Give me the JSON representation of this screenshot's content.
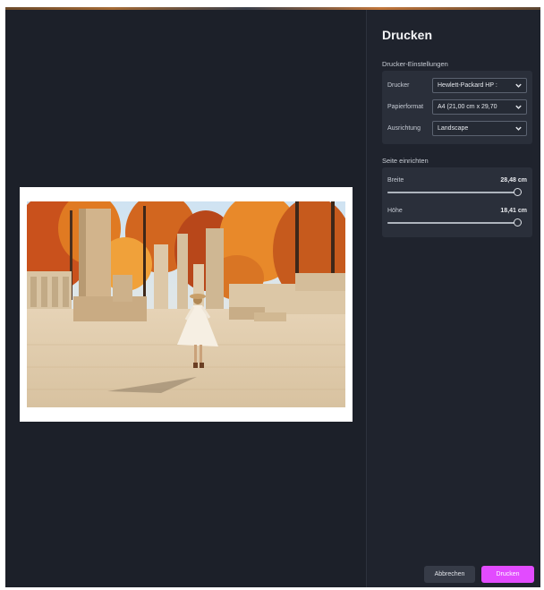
{
  "dialog": {
    "title": "Drucken",
    "printer_section_label": "Drucker-Einstellungen",
    "page_section_label": "Seite einrichten"
  },
  "printer_settings": {
    "printer": {
      "label": "Drucker",
      "value": "Hewlett-Packard HP :"
    },
    "paper_format": {
      "label": "Papierformat",
      "value": "A4 (21,00 cm x 29,70"
    },
    "orientation": {
      "label": "Ausrichtung",
      "value": "Landscape"
    }
  },
  "page_setup": {
    "width": {
      "label": "Breite",
      "value": "28,48 cm",
      "level": 1.0
    },
    "height": {
      "label": "Höhe",
      "value": "18,41 cm",
      "level": 1.0
    }
  },
  "buttons": {
    "cancel": "Abbrechen",
    "print": "Drucken"
  },
  "colors": {
    "background": "#1c2029",
    "accent": "#e24bff",
    "card": "#2a2f3a"
  },
  "icons": {
    "dropdown": "chevron-down-icon",
    "preview": "photo-preview"
  }
}
